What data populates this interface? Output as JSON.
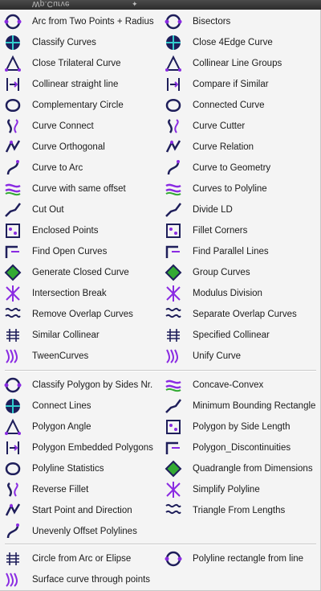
{
  "window": {
    "title": "Wp.Curve",
    "pin_icon": "pin-icon"
  },
  "colors": {
    "icon_dark": "#1e1e5a",
    "icon_accent": "#8a2be2",
    "background": "#f4f4f4"
  },
  "groups": [
    {
      "left": [
        {
          "label": "Arc from Two Points + Radius",
          "icon": "arc-radius-icon"
        },
        {
          "label": "Classify Curves",
          "icon": "classify-curves-icon"
        },
        {
          "label": "Close Trilateral Curve",
          "icon": "close-trilateral-icon"
        },
        {
          "label": "Collinear straight line",
          "icon": "collinear-line-icon"
        },
        {
          "label": "Complementary Circle",
          "icon": "complementary-circle-icon"
        },
        {
          "label": "Curve Connect",
          "icon": "curve-connect-icon"
        },
        {
          "label": "Curve Orthogonal",
          "icon": "curve-orthogonal-icon"
        },
        {
          "label": "Curve to Arc",
          "icon": "curve-to-arc-icon"
        },
        {
          "label": "Curve with same offset",
          "icon": "curve-offset-icon"
        },
        {
          "label": "Cut Out",
          "icon": "cut-out-icon"
        },
        {
          "label": "Enclosed Points",
          "icon": "enclosed-points-icon"
        },
        {
          "label": "Find Open Curves",
          "icon": "find-open-curves-icon"
        },
        {
          "label": "Generate Closed Curve",
          "icon": "generate-closed-curve-icon"
        },
        {
          "label": "Intersection Break",
          "icon": "intersection-break-icon"
        },
        {
          "label": "Remove Overlap Curves",
          "icon": "remove-overlap-icon"
        },
        {
          "label": "Similar Collinear",
          "icon": "similar-collinear-icon"
        },
        {
          "label": "TweenCurves",
          "icon": "tween-curves-icon"
        }
      ],
      "right": [
        {
          "label": "Bisectors",
          "icon": "bisectors-icon"
        },
        {
          "label": "Close 4Edge Curve",
          "icon": "close-4edge-icon"
        },
        {
          "label": "Collinear Line Groups",
          "icon": "collinear-groups-icon"
        },
        {
          "label": "Compare if Similar",
          "icon": "compare-similar-icon"
        },
        {
          "label": "Connected Curve",
          "icon": "connected-curve-icon"
        },
        {
          "label": "Curve Cutter",
          "icon": "curve-cutter-icon"
        },
        {
          "label": "Curve Relation",
          "icon": "curve-relation-icon"
        },
        {
          "label": "Curve to Geometry",
          "icon": "curve-to-geometry-icon"
        },
        {
          "label": "Curves to Polyline",
          "icon": "curves-to-polyline-icon"
        },
        {
          "label": "Divide LD",
          "icon": "divide-ld-icon"
        },
        {
          "label": "Fillet Corners",
          "icon": "fillet-corners-icon"
        },
        {
          "label": "Find Parallel Lines",
          "icon": "parallel-lines-icon"
        },
        {
          "label": "Group Curves",
          "icon": "group-curves-icon"
        },
        {
          "label": "Modulus Division",
          "icon": "modulus-division-icon"
        },
        {
          "label": "Separate Overlap Curves",
          "icon": "separate-overlap-icon"
        },
        {
          "label": "Specified Collinear",
          "icon": "specified-collinear-icon"
        },
        {
          "label": "Unify Curve",
          "icon": "unify-curve-icon"
        }
      ]
    },
    {
      "left": [
        {
          "label": "Classify Polygon by Sides Nr.",
          "icon": "classify-polygon-icon"
        },
        {
          "label": "Connect Lines",
          "icon": "connect-lines-icon"
        },
        {
          "label": "Polygon Angle",
          "icon": "polygon-angle-icon"
        },
        {
          "label": "Polygon Embedded Polygons",
          "icon": "embedded-polygons-icon"
        },
        {
          "label": "Polyline Statistics",
          "icon": "polyline-statistics-icon"
        },
        {
          "label": "Reverse Fillet",
          "icon": "reverse-fillet-icon"
        },
        {
          "label": "Start Point and Direction",
          "icon": "start-point-icon"
        },
        {
          "label": "Unevenly Offset Polylines",
          "icon": "uneven-offset-icon"
        }
      ],
      "right": [
        {
          "label": "Concave-Convex",
          "icon": "concave-convex-icon"
        },
        {
          "label": "Minimum Bounding Rectangle",
          "icon": "bounding-rectangle-icon"
        },
        {
          "label": "Polygon by Side Length",
          "icon": "polygon-side-length-icon"
        },
        {
          "label": "Polygon_Discontinuities",
          "icon": "polygon-discontinuities-icon"
        },
        {
          "label": "Quadrangle from Dimensions",
          "icon": "quadrangle-icon"
        },
        {
          "label": "Simplify Polyline",
          "icon": "simplify-polyline-icon"
        },
        {
          "label": "Triangle From Lengths",
          "icon": "triangle-lengths-icon"
        }
      ]
    },
    {
      "left": [
        {
          "label": "Circle from Arc or Elipse",
          "icon": "circle-from-arc-icon"
        },
        {
          "label": "Surface curve through points",
          "icon": "surface-curve-icon"
        }
      ],
      "right": [
        {
          "label": "Polyline rectangle from line",
          "icon": "polyline-rectangle-icon"
        }
      ]
    }
  ]
}
